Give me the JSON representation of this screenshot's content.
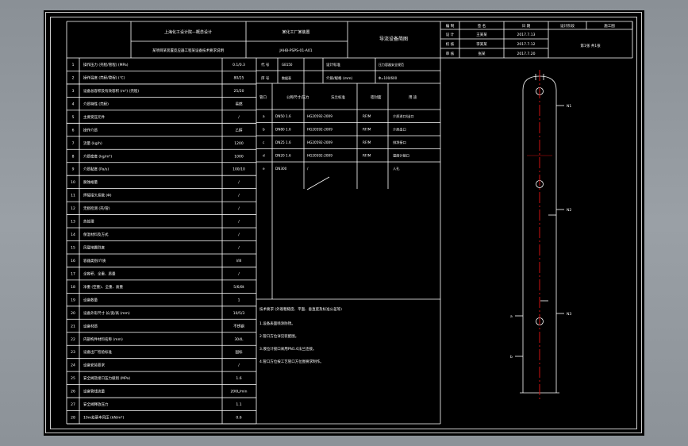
{
  "title_block": {
    "company": "上海化工设计院—概念设计",
    "plant": "某化工厂某装置",
    "drawing_title": "导流设备简图",
    "project": "某项目某装置反应器工程某设备技术要求说明",
    "drawing_no": "JAHB-PSPS-01-A01",
    "sign_headers": [
      "编 制",
      "签 名",
      "日 期"
    ],
    "sign_rows": [
      {
        "role": "设 计",
        "name": "王某某",
        "date": "2017.7.13"
      },
      {
        "role": "校 核",
        "name": "李某某",
        "date": "2017.7.12"
      },
      {
        "role": "审 核",
        "name": "张某",
        "date": "2017.7.20"
      }
    ],
    "stage_label": "设计阶段",
    "stage_value": "施工图",
    "sheet_info": "第1张 共1张"
  },
  "spec_rows": [
    {
      "no": "1",
      "label": "操作压力 (壳程/管程) (MPa)",
      "value": "0.1/0.3"
    },
    {
      "no": "2",
      "label": "操作温度 (壳程/管程) (℃)",
      "value": "80/25"
    },
    {
      "no": "3",
      "label": "设备总容积及有效容积 (m³) (壳程)",
      "value": "25/20"
    },
    {
      "no": "4",
      "label": "介质特性 (壳程)",
      "value": "易燃"
    },
    {
      "no": "5",
      "label": "主要受压元件",
      "value": "/"
    },
    {
      "no": "6",
      "label": "操作介质",
      "value": "乙醇"
    },
    {
      "no": "7",
      "label": "流量 (kg/h)",
      "value": "1200"
    },
    {
      "no": "8",
      "label": "介质密度 (kg/m³)",
      "value": "1000"
    },
    {
      "no": "9",
      "label": "介质黏度 (Pa/s)",
      "value": "100/10"
    },
    {
      "no": "10",
      "label": "腐蚀裕量",
      "value": "/"
    },
    {
      "no": "11",
      "label": "焊接接头系数 (Φ)",
      "value": "/"
    },
    {
      "no": "12",
      "label": "无损检测 (壳/管)",
      "value": "/"
    },
    {
      "no": "13",
      "label": "热处理",
      "value": "/"
    },
    {
      "no": "14",
      "label": "保温材料及方式",
      "value": "/"
    },
    {
      "no": "15",
      "label": "风载地震烈度",
      "value": "/"
    },
    {
      "no": "16",
      "label": "容器类别/介质",
      "value": "I/III"
    },
    {
      "no": "17",
      "label": "全容积、全重、质量",
      "value": "/"
    },
    {
      "no": "18",
      "label": "净重 (空重)、全重、质重",
      "value": "5/6/8t"
    },
    {
      "no": "19",
      "label": "设备数量",
      "value": "1"
    },
    {
      "no": "20",
      "label": "设备外形尺寸 长/宽/高 (mm)",
      "value": "10/5/3"
    },
    {
      "no": "21",
      "label": "设备材质",
      "value": "不锈钢"
    },
    {
      "no": "22",
      "label": "内部构件材料名称 (mm)",
      "value": "304L"
    },
    {
      "no": "23",
      "label": "设备出厂检验标准",
      "value": "国标"
    },
    {
      "no": "24",
      "label": "设备安装要求",
      "value": "/"
    },
    {
      "no": "25",
      "label": "安全阀及接口压力级别 (MPa)",
      "value": "1.6"
    },
    {
      "no": "26",
      "label": "设备管线流量",
      "value": "200L/min"
    },
    {
      "no": "27",
      "label": "安全阀释放压力",
      "value": "1.1"
    },
    {
      "no": "28",
      "label": "10m处基本风压 (kN/m²)",
      "value": "0.6"
    }
  ],
  "design_info": {
    "code_label": "代 号",
    "code_value": "GB150",
    "standard_label": "设计标准",
    "standard_value": "压力容器安全规范",
    "series_label": "序 号",
    "series_value": "数据表",
    "spec_label": "介质/规格 (mm)",
    "spec_value": "Φ=100/600"
  },
  "nozzle_table": {
    "headers": [
      "管口",
      "公称尺寸/压力",
      "法兰标准",
      "密封面",
      "用 途"
    ],
    "rows": [
      {
        "tag": "a",
        "size": "DN50 1.6",
        "flange": "HG20592-2009",
        "face": "RF/M",
        "use": "介质进口/出口"
      },
      {
        "tag": "b",
        "size": "DN80 1.6",
        "flange": "HG20592-2009",
        "face": "RF/M",
        "use": "介质出口"
      },
      {
        "tag": "c",
        "size": "DN25 1.6",
        "flange": "HG20592-2009",
        "face": "RF/M",
        "use": "排净接口"
      },
      {
        "tag": "d",
        "size": "DN20 1.6",
        "flange": "HG20592-2009",
        "face": "RF/M",
        "use": "温度计接口"
      },
      {
        "tag": "e",
        "size": "DN300",
        "flange": "/",
        "face": "",
        "use": "人孔"
      }
    ]
  },
  "notes": {
    "title": "技术要求 (外观粗糙度、平面、垂直度及标准公差等)",
    "items": [
      "1.设备表面喷涂防锈。",
      "2.管口方位详见装配图。",
      "3.液位计接口采用PN1.6法兰连接。",
      "4.管口方位按工艺管口方位图要求制作。"
    ]
  },
  "vessel_labels": {
    "top_nozzle": "N1",
    "middle_nozzle": "N2",
    "bottom_nozzle": "N3",
    "side_a": "a",
    "side_b": "b"
  },
  "colors": {
    "background": "#000000",
    "lines": "#ffffff",
    "centerline": "#d01010",
    "canvas": "#9aa0a6"
  }
}
